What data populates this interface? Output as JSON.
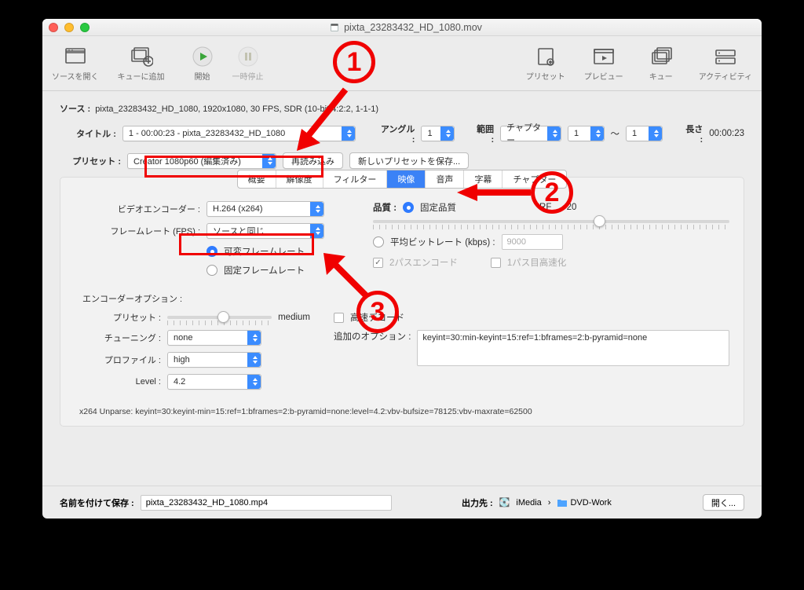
{
  "window": {
    "title": "pixta_23283432_HD_1080.mov"
  },
  "toolbar": {
    "open_source": "ソースを開く",
    "add_queue": "キューに追加",
    "start": "開始",
    "pause": "一時停止",
    "presets": "プリセット",
    "preview": "プレビュー",
    "queue": "キュー",
    "activity": "アクティビティ"
  },
  "source": {
    "label": "ソース :",
    "text": "pixta_23283432_HD_1080, 1920x1080, 30 FPS, SDR (10-bit 4:2:2, 1-1-1)"
  },
  "title": {
    "label": "タイトル :",
    "value": "1 - 00:00:23 - pixta_23283432_HD_1080",
    "angle_label": "アングル :",
    "angle_value": "1",
    "range_label": "範囲 :",
    "range_value": "チャプター",
    "chapter_from": "1",
    "chapter_to": "1",
    "duration_label": "長さ :",
    "duration_value": "00:00:23"
  },
  "preset": {
    "label": "プリセット :",
    "value": "Creator 1080p60 (編集済み)",
    "reload": "再読み込み",
    "save_new": "新しいプリセットを保存..."
  },
  "tabs": {
    "summary": "概要",
    "resolution": "解像度",
    "filters": "フィルター",
    "video": "映像",
    "audio": "音声",
    "subtitles": "字幕",
    "chapters": "チャプター"
  },
  "video": {
    "encoder_label": "ビデオエンコーダー :",
    "encoder_value": "H.264 (x264)",
    "fps_label": "フレームレート (FPS) :",
    "fps_value": "ソースと同じ",
    "vfr": "可変フレームレート",
    "cfr": "固定フレームレート",
    "quality_label": "品質 :",
    "cq": "固定品質",
    "rf_label": "RF",
    "rf_value": "20",
    "abr": "平均ビットレート (kbps) :",
    "abr_value": "9000",
    "twopass": "2パスエンコード",
    "turbo": "1パス目高速化"
  },
  "encopts": {
    "heading": "エンコーダーオプション :",
    "preset_label": "プリセット :",
    "preset_value": "medium",
    "tune_label": "チューニング :",
    "tune_value": "none",
    "fastdecode": "高速デコード",
    "profile_label": "プロファイル :",
    "profile_value": "high",
    "level_label": "Level :",
    "level_value": "4.2",
    "extra_label": "追加のオプション :",
    "extra_value": "keyint=30:min-keyint=15:ref=1:bframes=2:b-pyramid=none"
  },
  "unparse": "x264 Unparse: keyint=30:keyint-min=15:ref=1:bframes=2:b-pyramid=none:level=4.2:vbv-bufsize=78125:vbv-maxrate=62500",
  "footer": {
    "saveas_label": "名前を付けて保存 :",
    "saveas_value": "pixta_23283432_HD_1080.mp4",
    "dest_label": "出力先 :",
    "dest_path1": "iMedia",
    "dest_path2": "DVD-Work",
    "browse": "開く..."
  },
  "annotations": {
    "n1": "1",
    "n2": "2",
    "n3": "3"
  }
}
